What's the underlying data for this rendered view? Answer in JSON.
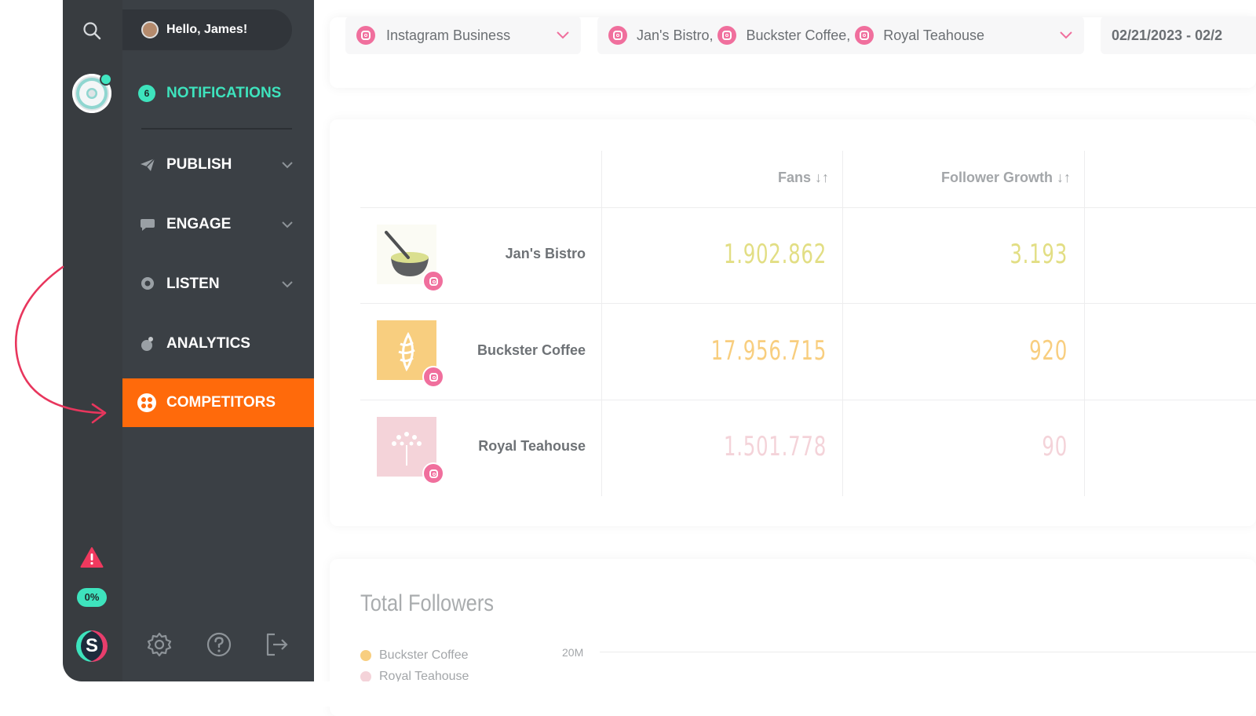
{
  "user": {
    "greeting": "Hello, James!"
  },
  "nav": {
    "notifications": {
      "count": "6",
      "label": "NOTIFICATIONS"
    },
    "items": [
      {
        "label": "PUBLISH",
        "icon": "paper-plane-icon",
        "expandable": true
      },
      {
        "label": "ENGAGE",
        "icon": "chat-bubble-icon",
        "expandable": true
      },
      {
        "label": "LISTEN",
        "icon": "ear-icon",
        "expandable": true
      },
      {
        "label": "ANALYTICS",
        "icon": "pie-chart-icon",
        "expandable": false
      },
      {
        "label": "COMPETITORS",
        "icon": "competitors-icon",
        "active": true
      }
    ],
    "progress_badge": "0%",
    "bottom": [
      "gear-icon",
      "help-icon",
      "logout-icon"
    ]
  },
  "filters": {
    "network": "Instagram Business",
    "profiles": [
      "Jan's Bistro,",
      "Buckster Coffee,",
      "Royal Teahouse"
    ],
    "date_range": "02/21/2023 - 02/2"
  },
  "table": {
    "columns": [
      "Fans ↓↑",
      "Follower Growth ↓↑"
    ],
    "rows": [
      {
        "name": "Jan's Bistro",
        "fans": "1.902.862",
        "growth": "3.193",
        "color": "#e2de84"
      },
      {
        "name": "Buckster Coffee",
        "fans": "17.956.715",
        "growth": "920",
        "color": "#f8ce7f"
      },
      {
        "name": "Royal Teahouse",
        "fans": "1.501.778",
        "growth": "90",
        "color": "#f4d3d9"
      }
    ]
  },
  "chart": {
    "title": "Total Followers",
    "legend": [
      {
        "name": "Buckster Coffee",
        "color": "#f8ce7f"
      },
      {
        "name": "Royal Teahouse",
        "color": "#f4d3d9"
      }
    ],
    "tick": "20M"
  },
  "colors": {
    "accent_active": "#ff6a0b",
    "accent_teal": "#3ee3bd",
    "instagram_pink": "#f06f9d",
    "annotation_arrow": "#e8365d"
  }
}
